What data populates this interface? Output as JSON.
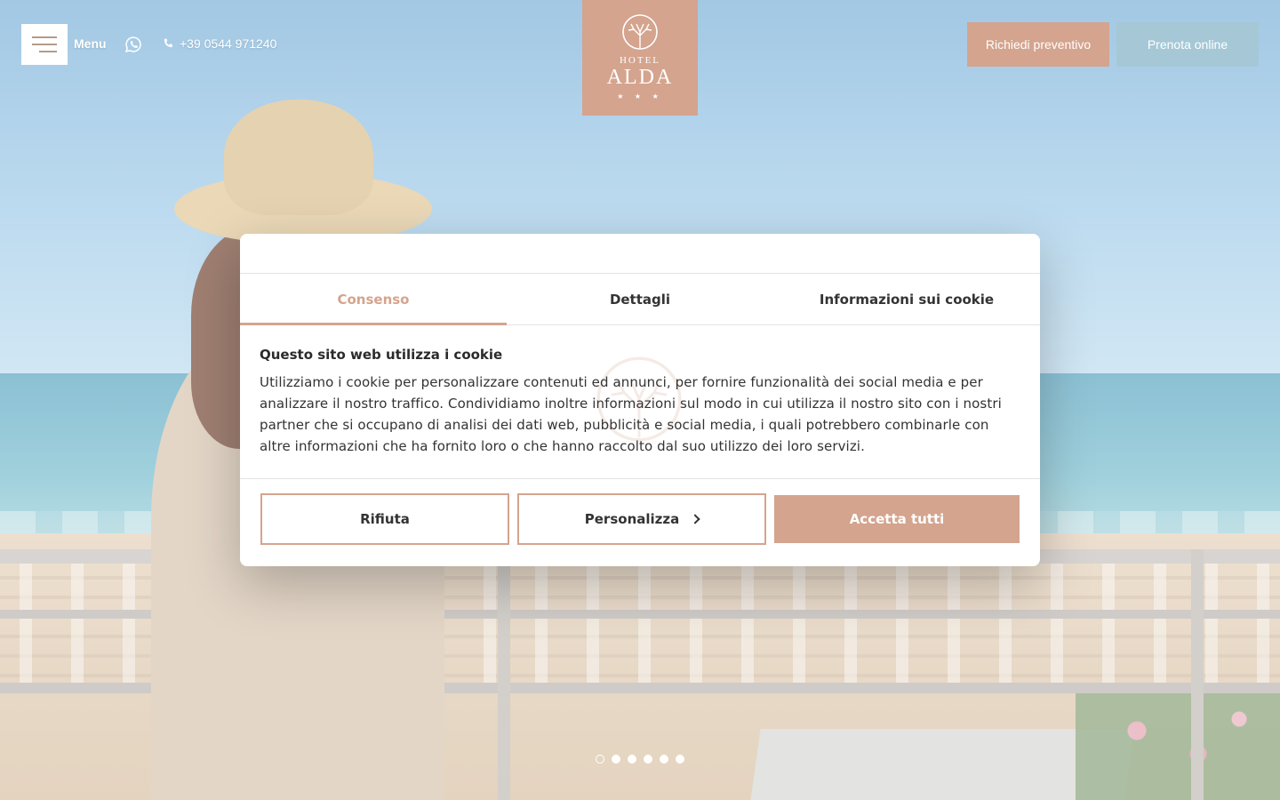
{
  "header": {
    "menu_label": "Menu",
    "phone": "+39 0544 971240",
    "logo": {
      "line1": "HOTEL",
      "line2": "ALDA",
      "stars": "★ ★ ★"
    },
    "quote_button": "Richiedi preventivo",
    "book_button": "Prenota online"
  },
  "icons": {
    "menu": "hamburger-icon",
    "whatsapp": "whatsapp-icon",
    "phone": "phone-icon",
    "logo": "tree-icon",
    "personalize": "chevron-right-icon"
  },
  "cookie_dialog": {
    "tabs": [
      {
        "label": "Consenso",
        "active": true
      },
      {
        "label": "Dettagli",
        "active": false
      },
      {
        "label": "Informazioni sui cookie",
        "active": false
      }
    ],
    "title": "Questo sito web utilizza i cookie",
    "text": "Utilizziamo i cookie per personalizzare contenuti ed annunci, per fornire funzionalità dei social media e per analizzare il nostro traffico. Condividiamo inoltre informazioni sul modo in cui utilizza il nostro sito con i nostri partner che si occupano di analisi dei dati web, pubblicità e social media, i quali potrebbero combinarle con altre informazioni che ha fornito loro o che hanno raccolto dal suo utilizzo dei loro servizi.",
    "buttons": {
      "reject": "Rifiuta",
      "customize": "Personalizza",
      "accept": "Accetta tutti"
    }
  },
  "slider": {
    "total": 6,
    "active_index": 0
  },
  "colors": {
    "accent": "#d4a48e",
    "secondary": "#a6c8d6",
    "text": "#333333"
  }
}
